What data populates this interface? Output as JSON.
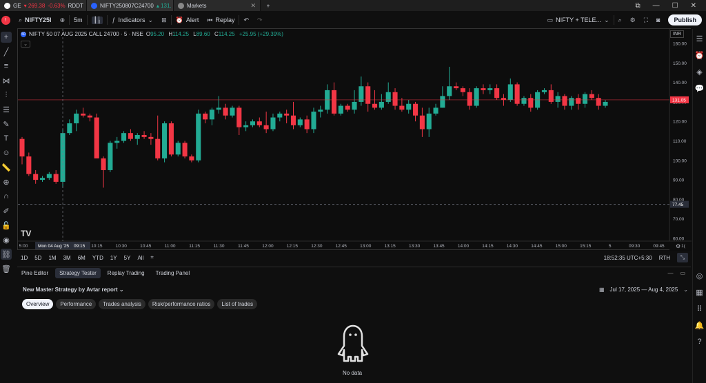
{
  "tabs": [
    {
      "label": "GE",
      "price": "269.38",
      "change": "-0.63%",
      "extra": "RDDT",
      "active": false
    },
    {
      "label": "NIFTY250807C24700",
      "price": "131.",
      "change": "",
      "extra": "",
      "active": true
    },
    {
      "label": "Markets",
      "price": "",
      "change": "",
      "extra": "",
      "active": false
    }
  ],
  "toolbar": {
    "symbol": "NIFTY25I",
    "interval": "5m",
    "indicators": "Indicators",
    "alert": "Alert",
    "replay": "Replay",
    "layout_name": "NIFTY + TELE...",
    "publish": "Publish"
  },
  "chart": {
    "title": "NIFTY 50 07 AUG 2025 CALL 24700 · 5 · NSE",
    "ohlc": {
      "o": "95.20",
      "h": "114.25",
      "l": "89.60",
      "c": "114.25",
      "chg": "+25.95 (+29.39%)"
    },
    "currency": "INR",
    "current_price": "131.05",
    "crosshair_price": "77.45",
    "crosshair_date": "Mon 04 Aug '25",
    "crosshair_time": "09:15",
    "price_ticks": [
      "160.00",
      "150.00",
      "140.00",
      "130.00",
      "120.00",
      "110.00",
      "100.00",
      "90.00",
      "80.00",
      "70.00",
      "60.00"
    ],
    "time_ticks": [
      "5:00",
      "09:45",
      "10:00",
      "10:15",
      "10:30",
      "10:45",
      "11:00",
      "11:15",
      "11:30",
      "11:45",
      "12:00",
      "12:15",
      "12:30",
      "12:45",
      "13:00",
      "13:15",
      "13:30",
      "13:45",
      "14:00",
      "14:15",
      "14:30",
      "14:45",
      "15:00",
      "15:15",
      "5",
      "09:30",
      "09:45",
      "1("
    ],
    "colors": {
      "up": "#22ab94",
      "down": "#f23645",
      "price_line": "#f23645"
    }
  },
  "chart_data": {
    "type": "candlestick",
    "ylim": [
      60,
      160
    ],
    "candles": [
      [
        111,
        112,
        98,
        102
      ],
      [
        102,
        104,
        92,
        93
      ],
      [
        93,
        95,
        88,
        90
      ],
      [
        90,
        92,
        89,
        91
      ],
      [
        91,
        94,
        90,
        93
      ],
      [
        93,
        95,
        88,
        89
      ],
      [
        89,
        116,
        86,
        114
      ],
      [
        114,
        121,
        113,
        119
      ],
      [
        119,
        126,
        115,
        124
      ],
      [
        124,
        127,
        122,
        123
      ],
      [
        123,
        124,
        120,
        122
      ],
      [
        122,
        124,
        111,
        101
      ],
      [
        101,
        102,
        86,
        95
      ],
      [
        95,
        110,
        94,
        109
      ],
      [
        109,
        112,
        106,
        110
      ],
      [
        110,
        115,
        109,
        114
      ],
      [
        114,
        116,
        110,
        111
      ],
      [
        111,
        114,
        108,
        113
      ],
      [
        113,
        115,
        111,
        112
      ],
      [
        112,
        114,
        108,
        111
      ],
      [
        111,
        123,
        100,
        101
      ],
      [
        101,
        120,
        99,
        119
      ],
      [
        119,
        120,
        102,
        103
      ],
      [
        103,
        110,
        102,
        109
      ],
      [
        109,
        110,
        101,
        102
      ],
      [
        102,
        103,
        99,
        100
      ],
      [
        100,
        126,
        99,
        124
      ],
      [
        124,
        125,
        119,
        121
      ],
      [
        121,
        127,
        118,
        126
      ],
      [
        126,
        133,
        124,
        127
      ],
      [
        127,
        129,
        121,
        123
      ],
      [
        123,
        128,
        122,
        127
      ],
      [
        127,
        128,
        113,
        117
      ],
      [
        117,
        120,
        115,
        118
      ],
      [
        118,
        121,
        117,
        120
      ],
      [
        120,
        122,
        117,
        118
      ],
      [
        118,
        125,
        114,
        116
      ],
      [
        116,
        124,
        115,
        122
      ],
      [
        122,
        125,
        120,
        124
      ],
      [
        124,
        126,
        119,
        123
      ],
      [
        123,
        130,
        116,
        118
      ],
      [
        118,
        122,
        117,
        121
      ],
      [
        121,
        123,
        114,
        116
      ],
      [
        116,
        127,
        114,
        125
      ],
      [
        125,
        128,
        122,
        126
      ],
      [
        126,
        139,
        124,
        136
      ],
      [
        136,
        140,
        123,
        124
      ],
      [
        124,
        129,
        123,
        128
      ],
      [
        128,
        129,
        125,
        126
      ],
      [
        126,
        136,
        124,
        130
      ],
      [
        130,
        143,
        128,
        138
      ],
      [
        138,
        140,
        125,
        129
      ],
      [
        129,
        136,
        126,
        127
      ],
      [
        127,
        134,
        126,
        130
      ],
      [
        130,
        140,
        129,
        135
      ],
      [
        135,
        137,
        126,
        128
      ],
      [
        128,
        132,
        125,
        126
      ],
      [
        126,
        131,
        124,
        129
      ],
      [
        129,
        130,
        120,
        123
      ],
      [
        123,
        127,
        112,
        116
      ],
      [
        116,
        127,
        112,
        124
      ],
      [
        124,
        129,
        123,
        127
      ],
      [
        127,
        138,
        127,
        133
      ],
      [
        133,
        148,
        131,
        138
      ],
      [
        138,
        140,
        136,
        137
      ],
      [
        137,
        138,
        133,
        135
      ],
      [
        135,
        137,
        126,
        128
      ],
      [
        128,
        138,
        127,
        137
      ],
      [
        137,
        139,
        134,
        136
      ],
      [
        136,
        139,
        134,
        137
      ],
      [
        137,
        139,
        131,
        132
      ],
      [
        132,
        134,
        128,
        131
      ],
      [
        131,
        142,
        130,
        139
      ],
      [
        139,
        140,
        128,
        129
      ],
      [
        129,
        133,
        128,
        132
      ],
      [
        132,
        134,
        125,
        127
      ],
      [
        127,
        136,
        126,
        135
      ],
      [
        135,
        137,
        134,
        136
      ],
      [
        136,
        139,
        129,
        130
      ],
      [
        130,
        135,
        127,
        133
      ],
      [
        133,
        134,
        126,
        128
      ],
      [
        128,
        133,
        126,
        132
      ],
      [
        132,
        134,
        126,
        129
      ],
      [
        129,
        135,
        127,
        134
      ],
      [
        134,
        136,
        131,
        132
      ],
      [
        132,
        134,
        126,
        128
      ],
      [
        128,
        131,
        127,
        130
      ]
    ]
  },
  "rangebar": {
    "ranges": [
      "1D",
      "5D",
      "1M",
      "3M",
      "6M",
      "YTD",
      "1Y",
      "5Y",
      "All"
    ],
    "time": "18:52:35 UTC+5:30",
    "rth": "RTH"
  },
  "panel": {
    "tabs": [
      "Pine Editor",
      "Strategy Tester",
      "Replay Trading",
      "Trading Panel"
    ],
    "active_tab": "Strategy Tester",
    "strategy_name": "New Master Strategy by Avtar report",
    "date_range": "Jul 17, 2025 — Aug 4, 2025",
    "subtabs": [
      "Overview",
      "Performance",
      "Trades analysis",
      "Risk/performance ratios",
      "List of trades"
    ],
    "active_subtab": "Overview",
    "empty_text": "No data"
  }
}
